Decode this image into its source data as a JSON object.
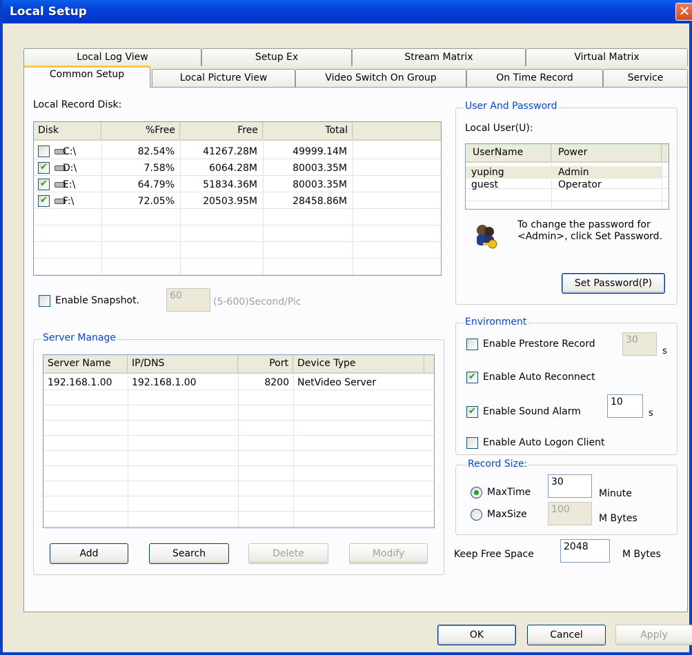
{
  "window": {
    "title": "Local Setup",
    "close_glyph": "✕"
  },
  "tabs_back": [
    "Local Log View",
    "Setup Ex",
    "Stream Matrix",
    "Virtual Matrix"
  ],
  "tabs_front": [
    "Common Setup",
    "Local Picture View",
    "Video Switch On Group",
    "On Time Record",
    "Service"
  ],
  "record_disk": {
    "label": "Local Record Disk:",
    "columns": [
      "Disk",
      "%Free",
      "Free",
      "Total"
    ],
    "rows": [
      {
        "checked": false,
        "disk": "C:\\",
        "pct_free": "82.54%",
        "free": "41267.28M",
        "total": "49999.14M"
      },
      {
        "checked": true,
        "disk": "D:\\",
        "pct_free": "7.58%",
        "free": "6064.28M",
        "total": "80003.35M"
      },
      {
        "checked": true,
        "disk": "E:\\",
        "pct_free": "64.79%",
        "free": "51834.36M",
        "total": "80003.35M"
      },
      {
        "checked": true,
        "disk": "F:\\",
        "pct_free": "72.05%",
        "free": "20503.95M",
        "total": "28458.86M"
      }
    ]
  },
  "snapshot": {
    "label": "Enable Snapshot.",
    "checked": false,
    "value": "60",
    "hint": "(5-600)Second/Pic"
  },
  "server_manage": {
    "title": "Server Manage",
    "columns": [
      "Server Name",
      "IP/DNS",
      "Port",
      "Device Type"
    ],
    "rows": [
      {
        "name": "192.168.1.00",
        "ip": "192.168.1.00",
        "port": "8200",
        "type": "NetVideo Server"
      }
    ],
    "buttons": {
      "add": "Add",
      "search": "Search",
      "delete": "Delete",
      "modify": "Modify"
    }
  },
  "user_password": {
    "title": "User And Password",
    "local_user_label": "Local User(U):",
    "columns": [
      "UserName",
      "Power"
    ],
    "rows": [
      {
        "name": "yuping",
        "power": "Admin"
      },
      {
        "name": "guest",
        "power": "Operator"
      }
    ],
    "info": "To change the password for <Admin>, click Set Password.",
    "set_password": "Set Password(P)"
  },
  "environment": {
    "title": "Environment",
    "prestore": {
      "label": "Enable Prestore Record",
      "checked": false,
      "value": "30",
      "unit": "s"
    },
    "auto_reconnect": {
      "label": "Enable Auto Reconnect",
      "checked": true
    },
    "sound_alarm": {
      "label": "Enable Sound Alarm",
      "checked": true,
      "value": "10",
      "unit": "s"
    },
    "auto_logon": {
      "label": "Enable Auto Logon Client",
      "checked": false
    }
  },
  "record_size": {
    "title": "Record Size:",
    "max_time": {
      "label": "MaxTime",
      "selected": true,
      "value": "30",
      "unit": "Minute"
    },
    "max_size": {
      "label": "MaxSize",
      "selected": false,
      "value": "100",
      "unit": "M Bytes"
    }
  },
  "keep_free": {
    "label": "Keep Free Space",
    "value": "2048",
    "unit": "M Bytes"
  },
  "footer": {
    "ok": "OK",
    "cancel": "Cancel",
    "apply": "Apply"
  },
  "colors": {
    "title_bar": "#0440d8",
    "group_title": "#0046d5",
    "check": "#21a121"
  }
}
